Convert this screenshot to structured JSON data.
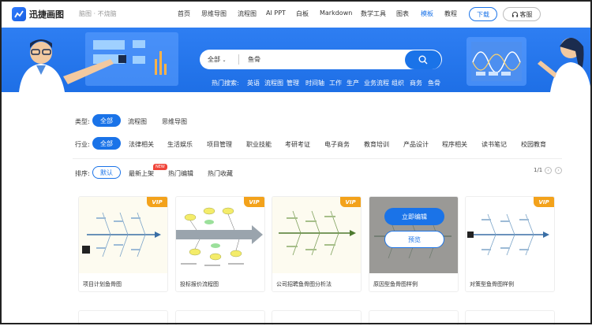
{
  "header": {
    "logo_text": "迅捷画图",
    "slogan": "脑图 · 不烧脑",
    "nav": [
      "首页",
      "思维导图",
      "流程图",
      "AI PPT",
      "白板",
      "Markdown",
      "数学工具",
      "图表",
      "模板",
      "教程"
    ],
    "active_nav": "模板",
    "download_label": "下载",
    "service_label": "客服"
  },
  "search": {
    "category": "全部",
    "value": "鱼骨",
    "hot_label": "热门搜索:",
    "hot_terms": [
      "英语",
      "流程图",
      "管理",
      "时间轴",
      "工作",
      "生产",
      "业务流程",
      "组织",
      "商务",
      "鱼骨"
    ]
  },
  "filters": {
    "type_label": "类型:",
    "types": [
      "全部",
      "流程图",
      "思维导图"
    ],
    "industry_label": "行业:",
    "industries": [
      "全部",
      "法律相关",
      "生活娱乐",
      "项目管理",
      "职业技能",
      "考研考证",
      "电子商务",
      "教育培训",
      "产品设计",
      "程序相关",
      "读书笔记",
      "校园教育"
    ],
    "sort_label": "排序:",
    "sorts": [
      "默认",
      "最新上架",
      "热门编辑",
      "热门收藏"
    ],
    "new_badge": "NEW",
    "page": "1/1"
  },
  "cards": [
    {
      "title": "项目计划鱼骨图",
      "vip": "VIP"
    },
    {
      "title": "投标报价流程图",
      "vip": "VIP"
    },
    {
      "title": "公司招聘鱼骨图分析法",
      "vip": "VIP"
    },
    {
      "title": "原因型鱼骨图样例",
      "vip": "",
      "edit_label": "立即编辑",
      "preview_label": "预览"
    },
    {
      "title": "对策型鱼骨图样例",
      "vip": "VIP"
    }
  ],
  "colors": {
    "accent": "#1a73e8",
    "banner": "#2e7ef2",
    "vip": "#f3a21b",
    "new": "#f0453a"
  }
}
